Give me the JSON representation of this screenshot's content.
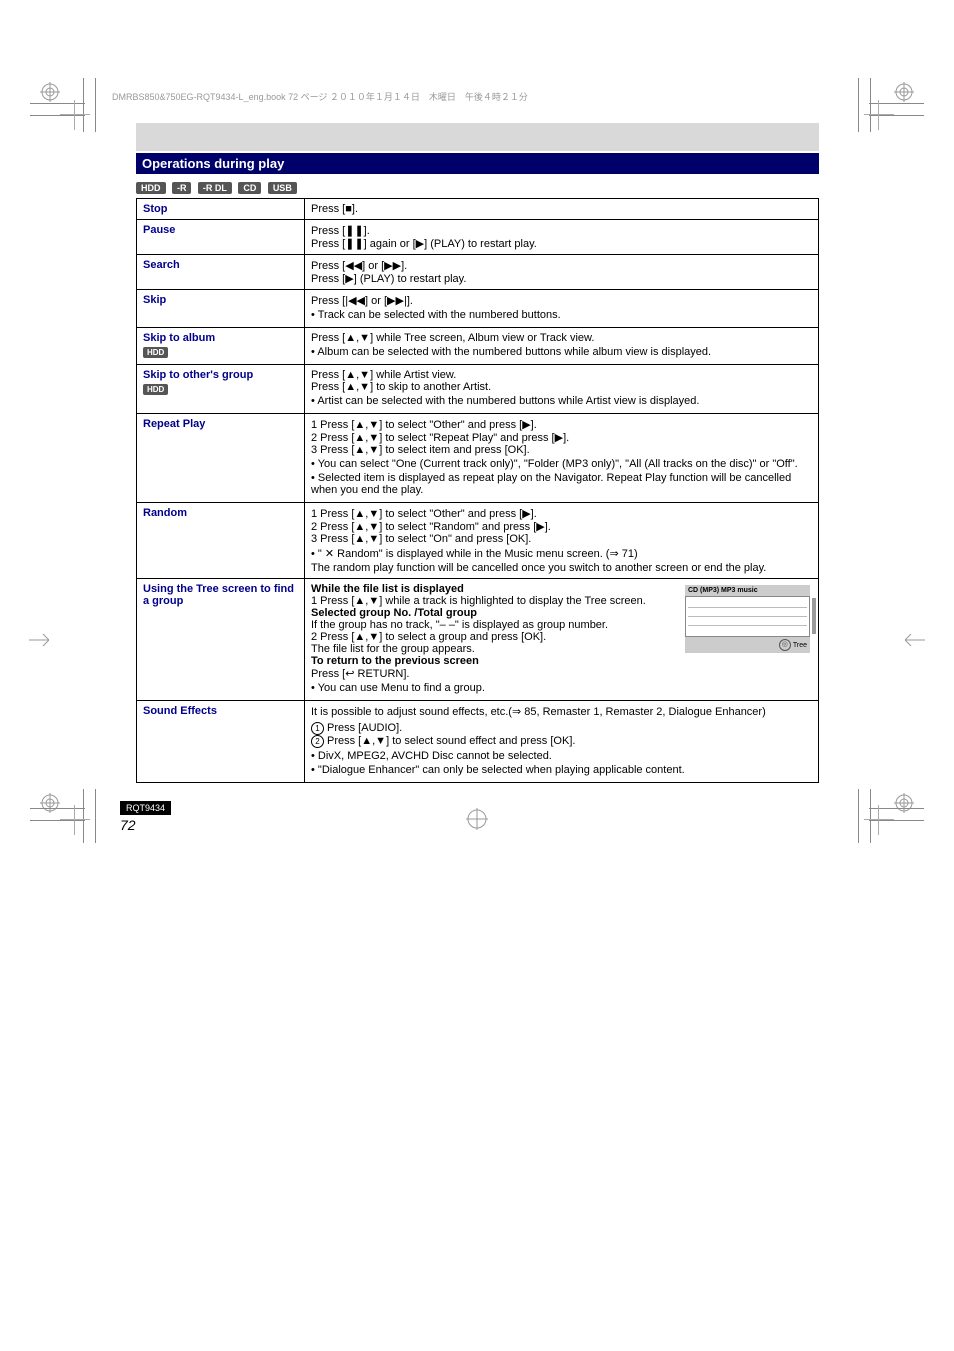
{
  "header_line": "DMRBS850&750EG-RQT9434-L_eng.book  72 ページ  ２０１０年１月１４日　木曜日　午後４時２１分",
  "section_title": "Operations during play",
  "tags": [
    "HDD",
    "-R",
    "-R DL",
    "CD",
    "USB"
  ],
  "rows": {
    "stop": {
      "label": "Stop",
      "body_pre": "Press [",
      "body_post": "]."
    },
    "pause": {
      "label": "Pause",
      "l1a": "Press [",
      "l1b": "].",
      "l2a": "Press [",
      "l2b": "] again or [",
      "l2c": "] (PLAY) to restart play."
    },
    "search": {
      "label": "Search",
      "l1a": "Press [",
      "l1b": "] or [",
      "l1c": "].",
      "l2a": "Press [",
      "l2b": "] (PLAY) to restart play."
    },
    "skip": {
      "label": "Skip",
      "l1a": "Press [",
      "l1b": "] or [",
      "l1c": "].",
      "bullet": "Track can be selected with the numbered buttons."
    },
    "skip_album": {
      "label": "Skip to album",
      "tag": "HDD",
      "l1a": "Press [",
      "l1b": "] while Tree screen, Album view or Track view.",
      "bullet": "Album can be selected with the numbered buttons while album view is displayed."
    },
    "skip_group": {
      "label": "Skip to other's group",
      "tag": "HDD",
      "l1a": "Press [",
      "l1b": "] while Artist view.",
      "l2a": "Press [",
      "l2b": "] to skip to another Artist.",
      "bullet": "Artist can be selected with the numbered buttons while Artist view is displayed."
    },
    "repeat": {
      "label": "Repeat Play",
      "l1a": "1  Press [",
      "l1b": "] to select \"Other\" and press [",
      "l1c": "].",
      "l2a": "2  Press [",
      "l2b": "] to select \"Repeat Play\" and press [",
      "l2c": "].",
      "l3a": "3  Press [",
      "l3b": "] to select item and press [OK].",
      "b1": "You can select \"One (Current track only)\", \"Folder (MP3 only)\", \"All (All tracks on the disc)\" or \"Off\".",
      "b2": "Selected item is displayed as repeat play on the Navigator. Repeat Play function will be cancelled when you end the play."
    },
    "random": {
      "label": "Random",
      "l1a": "1  Press [",
      "l1b": "] to select \"Other\" and press [",
      "l1c": "].",
      "l2a": "2  Press [",
      "l2b": "] to select \"Random\" and press [",
      "l2c": "].",
      "l3a": "3  Press [",
      "l3b": "] to select \"On\" and press [OK].",
      "b1a": "\" ",
      "b1b": " Random\" is displayed while in the Music menu screen. (",
      "b1c": " 71)",
      "b2": "The random play function will be cancelled once you switch to another screen or end the play."
    },
    "tree": {
      "label": "Using the Tree screen to find a group",
      "rightbox": {
        "header": "CD (MP3)     MP3 music",
        "footer_pre": "",
        "footer_post": "Tree"
      },
      "s1": "While the file list is displayed",
      "s2a": "1  Press [",
      "s2b": "] while a track is highlighted to display the Tree screen.",
      "s3": "Selected group No. /Total group",
      "s4": "If the group has no track, \"– –\" is displayed as group number.",
      "s5a": "2  Press [",
      "s5b": "] to select a group and press [OK].",
      "s6": "The file list for the group appears.",
      "retpre": "Press [",
      "retpost": " RETURN].",
      "bullet": "You can use Menu to find a group."
    },
    "sound": {
      "label": "Sound Effects",
      "l1a": "It is possible to adjust sound effects, etc.(",
      "l1b": " 85, Remaster 1, Remaster 2, Dialogue Enhancer)",
      "s1a": "Press [AUDIO].",
      "s2a": "Press [",
      "s2b": "] to select sound effect and press [OK].",
      "b1": "DivX, MPEG2, AVCHD Disc cannot be selected.",
      "b2": "\"Dialogue Enhancer\" can only be selected when playing applicable content."
    }
  },
  "footer": {
    "rqt": "RQT9434",
    "page_small": "72",
    "page_big": "72"
  }
}
